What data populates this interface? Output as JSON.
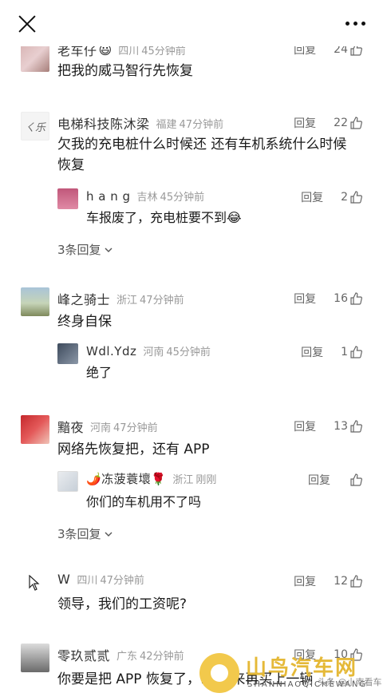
{
  "header": {
    "close_icon": "close-icon",
    "more_icon": "more-icon"
  },
  "comments": [
    {
      "name": "老车仔",
      "emoji": "😃",
      "location": "四川",
      "time": "45分钟前",
      "reply": "回复",
      "likes": "24",
      "text": "把我的威马智行先恢复"
    },
    {
      "name": "电梯科技陈沐梁",
      "location": "福建",
      "time": "47分钟前",
      "reply": "回复",
      "likes": "22",
      "text_line1": "欠我的充电桩什么时候还  还有车机系统什么时候",
      "text_line2": "恢复",
      "sub_reply": {
        "name": "h a n g",
        "location": "吉林",
        "time": "45分钟前",
        "reply": "回复",
        "likes": "2",
        "text": "车报废了，充电桩要不到😂"
      },
      "more_replies": "3条回复"
    },
    {
      "name": "峰之骑士",
      "location": "浙江",
      "time": "47分钟前",
      "reply": "回复",
      "likes": "16",
      "text": "终身自保",
      "sub_reply": {
        "name": "Wdl.Ydz",
        "location": "河南",
        "time": "45分钟前",
        "reply": "回复",
        "likes": "1",
        "text": "绝了"
      }
    },
    {
      "name": "黯夜",
      "location": "河南",
      "time": "47分钟前",
      "reply": "回复",
      "likes": "13",
      "text": "网络先恢复把，还有 APP",
      "sub_reply": {
        "name": "🌶️冻菠蓑壞🌹",
        "location": "浙江",
        "time": "刚刚",
        "reply": "回复",
        "likes": "",
        "text": "你们的车机用不了吗"
      },
      "more_replies": "3条回复"
    },
    {
      "name": "W",
      "location": "四川",
      "time": "47分钟前",
      "reply": "回复",
      "likes": "12",
      "text": "领导，我们的工资呢?"
    },
    {
      "name": "零玖贰贰",
      "location": "广东",
      "time": "42分钟前",
      "reply": "回复",
      "likes": "10",
      "text": "你要是把 APP 恢复了，… 车来再买上一辆"
    }
  ],
  "watermark": {
    "title": "山鸟汽车网",
    "subtitle": "SHANNIAOQICHEWANG",
    "tag": "头条 @小南看车"
  }
}
